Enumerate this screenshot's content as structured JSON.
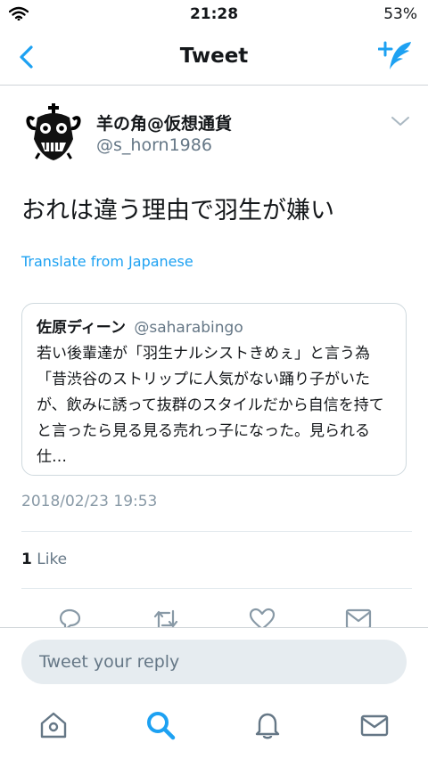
{
  "status_bar": {
    "time": "21:28",
    "battery": "53%"
  },
  "nav": {
    "title": "Tweet"
  },
  "tweet": {
    "author_name": "羊の角@仮想通貨",
    "author_handle": "@s_horn1986",
    "text": "おれは違う理由で羽生が嫌い",
    "translate_label": "Translate from Japanese",
    "timestamp": "2018/02/23 19:53",
    "likes_count": "1",
    "likes_label": "Like"
  },
  "quoted_tweet": {
    "author_name": "佐原ディーン",
    "author_handle": "@saharabingo",
    "text": "若い後輩達が「羽生ナルシストきめぇ」と言う為「昔渋谷のストリップに人気がない踊り子がいたが、飲みに誘って抜群のスタイルだから自信を持てと言ったら見る見る売れっ子になった。見られる仕…"
  },
  "reply": {
    "placeholder": "Tweet your reply"
  },
  "colors": {
    "accent": "#1da1f2",
    "secondary_text": "#657786",
    "icon_gray": "#8899a6"
  }
}
